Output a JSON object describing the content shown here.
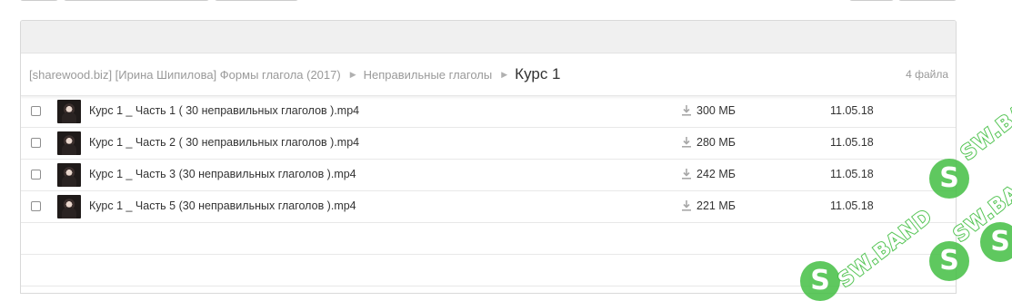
{
  "breadcrumb": {
    "items": [
      "[sharewood.biz] [Ирина Шипилова] Формы глагола (2017)",
      "Неправильные глаголы"
    ],
    "current": "Курс 1",
    "count": "4 файла"
  },
  "files": [
    {
      "name": "Курс 1 _ Часть 1 ( 30 неправильных глаголов ).mp4",
      "size": "300 МБ",
      "date": "11.05.18"
    },
    {
      "name": "Курс 1 _ Часть 2 ( 30 неправильных глаголов ).mp4",
      "size": "280 МБ",
      "date": "11.05.18"
    },
    {
      "name": "Курс 1 _ Часть 3 (30 неправильных глаголов ).mp4",
      "size": "242 МБ",
      "date": "11.05.18"
    },
    {
      "name": "Курс 1 _ Часть 5 (30 неправильных глаголов ).mp4",
      "size": "221 МБ",
      "date": "11.05.18"
    }
  ],
  "watermark": {
    "text": "SW.BAND",
    "color": "#44bf44"
  },
  "icons": {
    "download": "download-icon",
    "checkbox": "checkbox",
    "separator": "chevron-right-icon"
  }
}
